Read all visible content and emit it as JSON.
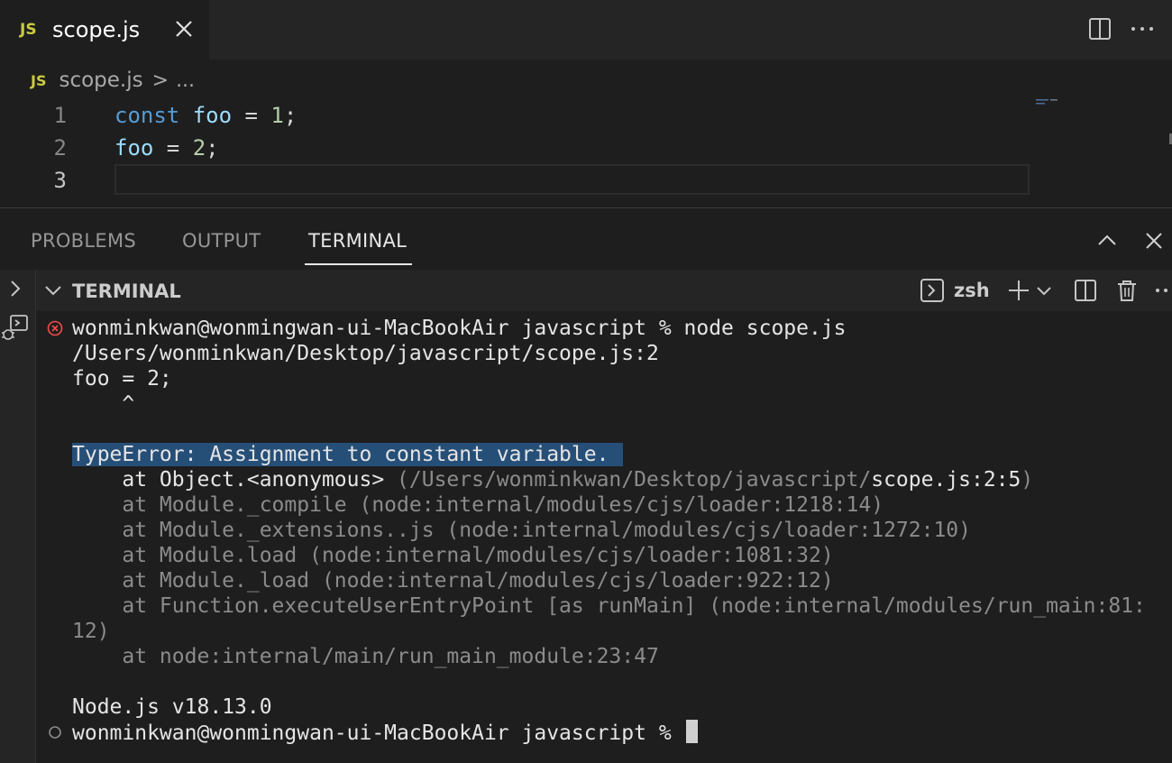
{
  "tab": {
    "badge": "JS",
    "filename": "scope.js"
  },
  "breadcrumb": {
    "badge": "JS",
    "file": "scope.js",
    "separator": ">",
    "more": "..."
  },
  "editor": {
    "lines": [
      {
        "number": "1",
        "tokens": [
          [
            "kw",
            "const"
          ],
          [
            "op",
            " "
          ],
          [
            "var",
            "foo"
          ],
          [
            "op",
            " = "
          ],
          [
            "num",
            "1"
          ],
          [
            "op",
            ";"
          ]
        ]
      },
      {
        "number": "2",
        "tokens": [
          [
            "var",
            "foo"
          ],
          [
            "op",
            " = "
          ],
          [
            "num",
            "2"
          ],
          [
            "op",
            ";"
          ]
        ]
      },
      {
        "number": "3",
        "tokens": []
      }
    ]
  },
  "panel": {
    "tabs": [
      "PROBLEMS",
      "OUTPUT",
      "TERMINAL"
    ],
    "active_tab": "TERMINAL"
  },
  "terminal": {
    "title": "TERMINAL",
    "shell": "zsh",
    "command_line": "wonminkwan@wonmingwan-ui-MacBookAir javascript % node scope.js",
    "output": {
      "path": "/Users/wonminkwan/Desktop/javascript/scope.js:2",
      "source": "foo = 2;",
      "caret": "    ^",
      "error": "TypeError: Assignment to constant variable.",
      "stack_first_prefix": "    at Object.<anonymous> ",
      "stack_first_path": "(/Users/wonminkwan/Desktop/javascript/",
      "stack_first_file": "scope.js:2:5",
      "stack_first_close": ")",
      "stack": [
        "    at Module._compile (node:internal/modules/cjs/loader:1218:14)",
        "    at Module._extensions..js (node:internal/modules/cjs/loader:1272:10)",
        "    at Module.load (node:internal/modules/cjs/loader:1081:32)",
        "    at Module._load (node:internal/modules/cjs/loader:922:12)",
        "    at Function.executeUserEntryPoint [as runMain] (node:internal/modules/run_main:81:",
        "12)",
        "    at node:internal/main/run_main_module:23:47"
      ],
      "version": "Node.js v18.13.0"
    },
    "prompt": "wonminkwan@wonmingwan-ui-MacBookAir javascript % "
  }
}
